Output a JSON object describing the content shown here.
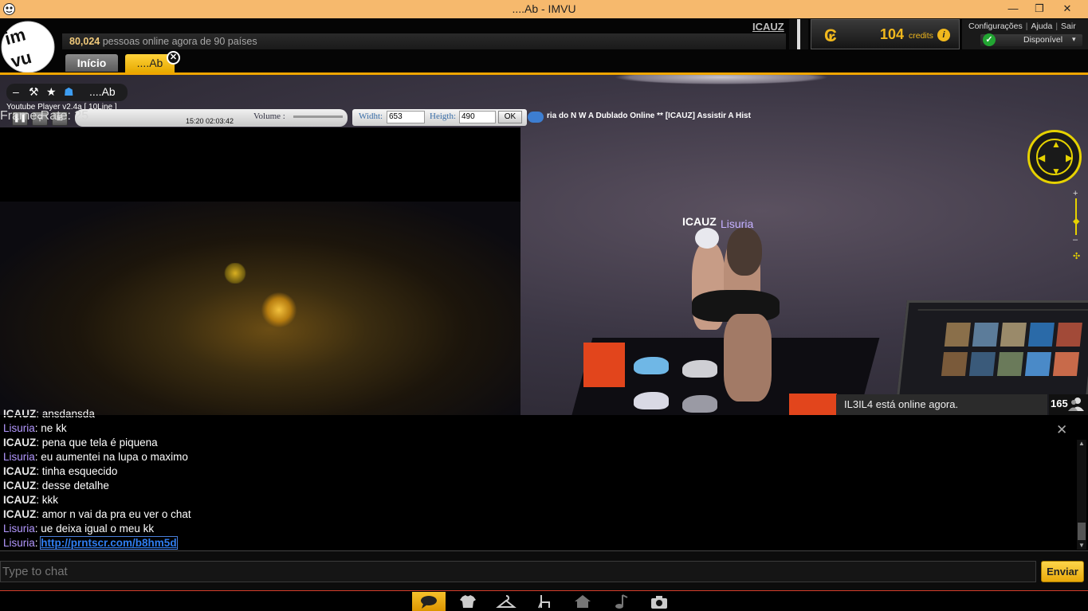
{
  "window": {
    "title": "....Ab - IMVU",
    "min": "—",
    "max": "❐",
    "close": "✕"
  },
  "header": {
    "online_count": "80,024",
    "online_rest": " pessoas online agora de 90 países",
    "username": "ICAUZ",
    "credits_value": "104",
    "credits_label": "credits",
    "links": [
      "Configurações",
      "Ajuda",
      "Sair"
    ],
    "status": "Disponível"
  },
  "tabs": {
    "home": "Início",
    "room": "....Ab"
  },
  "room_tools": {
    "name": "....Ab"
  },
  "youtube": {
    "title": "Youtube Player v2.4a [ 10Line ]",
    "frame_rate": "Frame Rate: 25",
    "time": "15:20 02:03:42",
    "volume_label": "Volume :",
    "width_label": "Widht:",
    "width_value": "653",
    "height_label": "Heigth:",
    "height_value": "490",
    "ok": "OK",
    "marquee": "ria do N W A   Dublado Online **  [ICAUZ] Assistir   A Hist"
  },
  "avatars": {
    "name1": "ICAUZ",
    "name2": "Lisuria"
  },
  "notification": {
    "text": "IL3IL4 está online agora.",
    "count": "165"
  },
  "chat": {
    "messages": [
      {
        "user": "ICAUZ",
        "sep": ": ",
        "text": "ansdansda"
      },
      {
        "user": "Lisuria",
        "sep": ": ",
        "text": "ne kk"
      },
      {
        "user": "ICAUZ",
        "sep": ": ",
        "text": "pena que tela é piquena"
      },
      {
        "user": "Lisuria",
        "sep": ": ",
        "text": "eu aumentei na lupa o maximo"
      },
      {
        "user": "ICAUZ",
        "sep": ": ",
        "text": "tinha esquecido"
      },
      {
        "user": "ICAUZ",
        "sep": ": ",
        "text": "desse detalhe"
      },
      {
        "user": "ICAUZ",
        "sep": ": ",
        "text": "kkk"
      },
      {
        "user": "ICAUZ",
        "sep": ": ",
        "text": "amor n vai da pra eu ver o chat"
      },
      {
        "user": "Lisuria",
        "sep": ": ",
        "text": "ue deixa igual o meu kk"
      },
      {
        "user": "Lisuria",
        "sep": ": ",
        "text": "http://prntscr.com/b8hm5d"
      }
    ],
    "placeholder": "Type to chat",
    "send": "Enviar"
  },
  "colors": {
    "accent": "#f0a500",
    "titlebar": "#f6b96d",
    "lisuria": "#b398ff",
    "link": "#2f7ef2"
  },
  "bottom_icons": [
    "chat-icon",
    "shirt-icon",
    "hanger-icon",
    "chair-icon",
    "home-icon",
    "music-icon",
    "camera-icon"
  ]
}
